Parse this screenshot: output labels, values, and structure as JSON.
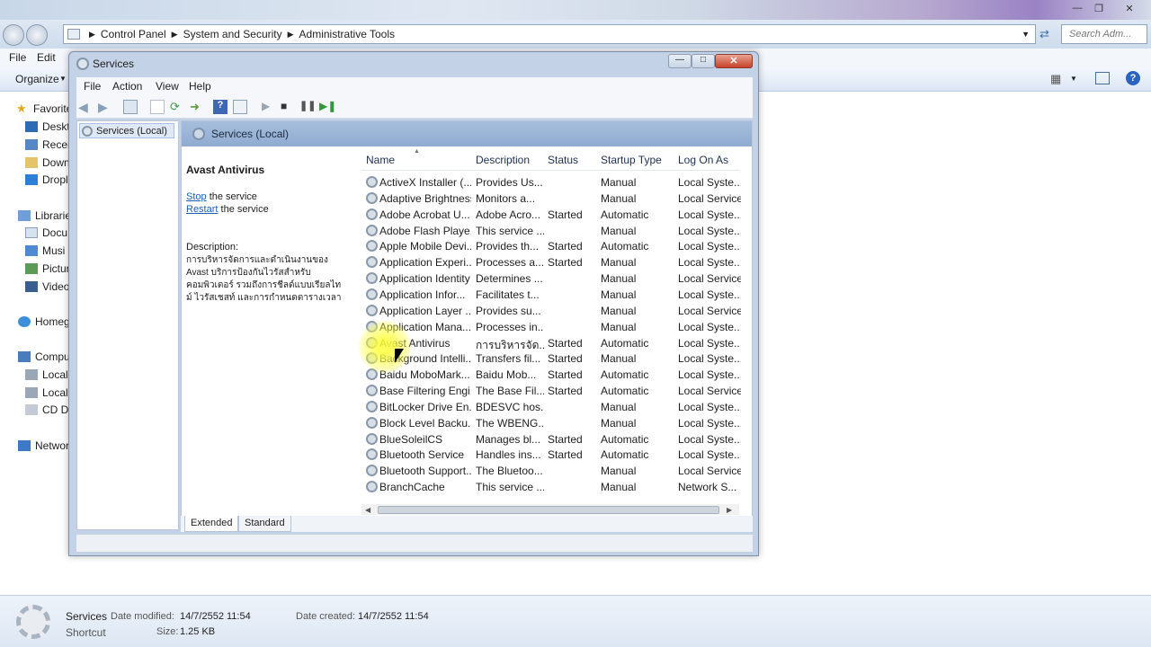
{
  "explorer": {
    "breadcrumbs": [
      "Control Panel",
      "System and Security",
      "Administrative Tools"
    ],
    "search_placeholder": "Search Adm...",
    "menu": [
      "File",
      "Edit"
    ],
    "organize_label": "Organize",
    "nav_items": [
      {
        "label": "Favorite",
        "icon": "star-icon"
      },
      {
        "label": "Deskt",
        "icon": "desktop-icon"
      },
      {
        "label": "Recen",
        "icon": "recent-icon"
      },
      {
        "label": "Down",
        "icon": "downloads-icon"
      },
      {
        "label": "Dropl",
        "icon": "dropbox-icon"
      },
      {
        "label": "Librarie",
        "icon": "libraries-icon"
      },
      {
        "label": "Docu",
        "icon": "documents-icon"
      },
      {
        "label": "Musi",
        "icon": "music-icon"
      },
      {
        "label": "Pictur",
        "icon": "pictures-icon"
      },
      {
        "label": "Video",
        "icon": "videos-icon"
      },
      {
        "label": "Homeg",
        "icon": "homegroup-icon"
      },
      {
        "label": "Compu",
        "icon": "computer-icon"
      },
      {
        "label": "Local",
        "icon": "drive-icon"
      },
      {
        "label": "Local",
        "icon": "drive-icon"
      },
      {
        "label": "CD Dr",
        "icon": "cd-drive-icon"
      },
      {
        "label": "Networ",
        "icon": "network-icon"
      }
    ],
    "details": {
      "name": "Services",
      "type": "Shortcut",
      "date_modified_label": "Date modified:",
      "date_modified": "14/7/2552 11:54",
      "date_created_label": "Date created:",
      "date_created": "14/7/2552 11:54",
      "size_label": "Size:",
      "size": "1.25 KB"
    }
  },
  "services_window": {
    "title": "Services",
    "menu": [
      "File",
      "Action",
      "View",
      "Help"
    ],
    "tree_item": "Services (Local)",
    "header_title": "Services (Local)",
    "selected_service": "Avast Antivirus",
    "stop_link": "Stop",
    "stop_rest": " the service",
    "restart_link": "Restart",
    "restart_rest": " the service",
    "description_label": "Description:",
    "description_lines": [
      "การบริหารจัดการและดำเนินงานของ",
      "Avast บริการป้องกันไวรัสสำหรับ",
      "คอมพิวเตอร์ รวมถึงการชีลด์แบบเรียลไท",
      "ม์ ไวรัสเชสท์ และการกำหนดตารางเวลา"
    ],
    "columns": [
      "Name",
      "Description",
      "Status",
      "Startup Type",
      "Log On As"
    ],
    "rows": [
      [
        "ActiveX Installer (...",
        "Provides Us...",
        "",
        "Manual",
        "Local Syste..."
      ],
      [
        "Adaptive Brightness",
        "Monitors a...",
        "",
        "Manual",
        "Local Service"
      ],
      [
        "Adobe Acrobat U...",
        "Adobe Acro...",
        "Started",
        "Automatic",
        "Local Syste..."
      ],
      [
        "Adobe Flash Playe...",
        "This service ...",
        "",
        "Manual",
        "Local Syste..."
      ],
      [
        "Apple Mobile Devi...",
        "Provides th...",
        "Started",
        "Automatic",
        "Local Syste..."
      ],
      [
        "Application Experi...",
        "Processes a...",
        "Started",
        "Manual",
        "Local Syste..."
      ],
      [
        "Application Identity",
        "Determines ...",
        "",
        "Manual",
        "Local Service"
      ],
      [
        "Application Infor...",
        "Facilitates t...",
        "",
        "Manual",
        "Local Syste..."
      ],
      [
        "Application Layer ...",
        "Provides su...",
        "",
        "Manual",
        "Local Service"
      ],
      [
        "Application Mana...",
        "Processes in...",
        "",
        "Manual",
        "Local Syste..."
      ],
      [
        "Avast Antivirus",
        "การบริหารจัด...",
        "Started",
        "Automatic",
        "Local Syste..."
      ],
      [
        "Background Intelli...",
        "Transfers fil...",
        "Started",
        "Manual",
        "Local Syste..."
      ],
      [
        "Baidu MoboMark...",
        "Baidu Mob...",
        "Started",
        "Automatic",
        "Local Syste..."
      ],
      [
        "Base Filtering Engi...",
        "The Base Fil...",
        "Started",
        "Automatic",
        "Local Service"
      ],
      [
        "BitLocker Drive En...",
        "BDESVC hos...",
        "",
        "Manual",
        "Local Syste..."
      ],
      [
        "Block Level Backu...",
        "The WBENG...",
        "",
        "Manual",
        "Local Syste..."
      ],
      [
        "BlueSoleilCS",
        "Manages bl...",
        "Started",
        "Automatic",
        "Local Syste..."
      ],
      [
        "Bluetooth Service",
        "Handles ins...",
        "Started",
        "Automatic",
        "Local Syste..."
      ],
      [
        "Bluetooth Support...",
        "The Bluetoo...",
        "",
        "Manual",
        "Local Service"
      ],
      [
        "BranchCache",
        "This service ...",
        "",
        "Manual",
        "Network S..."
      ]
    ],
    "tabs": [
      "Extended",
      "Standard"
    ]
  }
}
